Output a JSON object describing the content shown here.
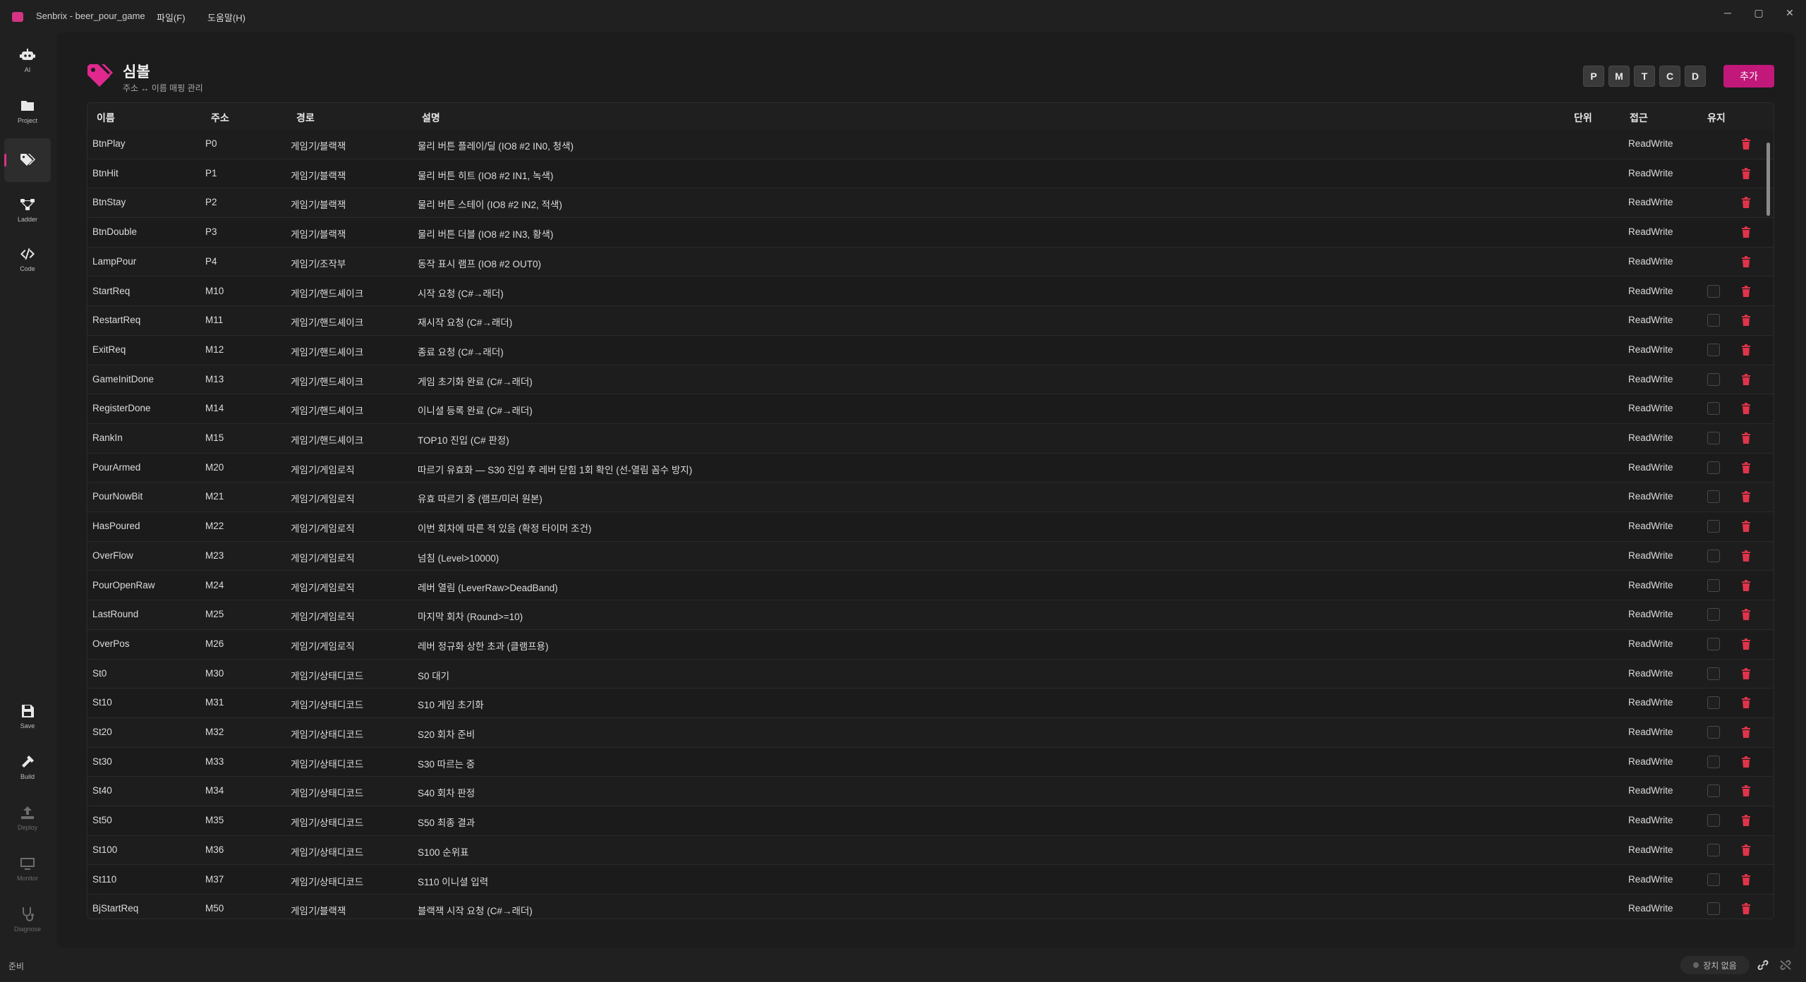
{
  "app": {
    "title": "Senbrix - beer_pour_game",
    "menu": [
      "파일(F)",
      "도움말(H)"
    ],
    "window_controls": [
      "─",
      "▢",
      "✕"
    ]
  },
  "rail": [
    {
      "label": "AI",
      "icon": "robot-icon",
      "active": false,
      "dim": false
    },
    {
      "label": "Project",
      "icon": "folder-icon",
      "active": false,
      "dim": false
    },
    {
      "label": "",
      "icon": "tag-icon",
      "active": true,
      "dim": false
    },
    {
      "label": "Ladder",
      "icon": "ladder-icon",
      "active": false,
      "dim": false
    },
    {
      "label": "Code",
      "icon": "code-icon",
      "active": false,
      "dim": false
    },
    {
      "label": "Save",
      "icon": "save-icon",
      "active": false,
      "dim": false
    },
    {
      "label": "Build",
      "icon": "hammer-icon",
      "active": false,
      "dim": false
    },
    {
      "label": "Deploy",
      "icon": "upload-icon",
      "active": false,
      "dim": true
    },
    {
      "label": "Monitor",
      "icon": "monitor-icon",
      "active": false,
      "dim": true
    },
    {
      "label": "Diagnose",
      "icon": "stethoscope-icon",
      "active": false,
      "dim": true
    }
  ],
  "header": {
    "title": "심볼",
    "subtitle": "주소 ↔ 이름 매핑 관리",
    "filters": [
      "P",
      "M",
      "T",
      "C",
      "D"
    ],
    "add_label": "추가",
    "accent": "#c2187a"
  },
  "table": {
    "columns": [
      "이름",
      "주소",
      "경로",
      "설명",
      "단위",
      "접근",
      "유지"
    ],
    "rows": [
      {
        "name": "BtnPlay",
        "addr": "P0",
        "path": "게임기/블랙잭",
        "desc": "물리 버튼 플레이/딜 (IO8 #2 IN0, 청색)",
        "unit": "",
        "access": "ReadWrite",
        "keep": false,
        "keep_visible": false
      },
      {
        "name": "BtnHit",
        "addr": "P1",
        "path": "게임기/블랙잭",
        "desc": "물리 버튼 히트 (IO8 #2 IN1, 녹색)",
        "unit": "",
        "access": "ReadWrite",
        "keep": false,
        "keep_visible": false
      },
      {
        "name": "BtnStay",
        "addr": "P2",
        "path": "게임기/블랙잭",
        "desc": "물리 버튼 스테이 (IO8 #2 IN2, 적색)",
        "unit": "",
        "access": "ReadWrite",
        "keep": false,
        "keep_visible": false
      },
      {
        "name": "BtnDouble",
        "addr": "P3",
        "path": "게임기/블랙잭",
        "desc": "물리 버튼 더블 (IO8 #2 IN3, 황색)",
        "unit": "",
        "access": "ReadWrite",
        "keep": false,
        "keep_visible": false
      },
      {
        "name": "LampPour",
        "addr": "P4",
        "path": "게임기/조작부",
        "desc": "동작 표시 램프 (IO8 #2 OUT0)",
        "unit": "",
        "access": "ReadWrite",
        "keep": false,
        "keep_visible": false
      },
      {
        "name": "StartReq",
        "addr": "M10",
        "path": "게임기/핸드셰이크",
        "desc": "시작 요청 (C#→래더)",
        "unit": "",
        "access": "ReadWrite",
        "keep": false,
        "keep_visible": true
      },
      {
        "name": "RestartReq",
        "addr": "M11",
        "path": "게임기/핸드셰이크",
        "desc": "재시작 요청 (C#→래더)",
        "unit": "",
        "access": "ReadWrite",
        "keep": false,
        "keep_visible": true
      },
      {
        "name": "ExitReq",
        "addr": "M12",
        "path": "게임기/핸드셰이크",
        "desc": "종료 요청 (C#→래더)",
        "unit": "",
        "access": "ReadWrite",
        "keep": false,
        "keep_visible": true
      },
      {
        "name": "GameInitDone",
        "addr": "M13",
        "path": "게임기/핸드셰이크",
        "desc": "게임 초기화 완료 (C#→래더)",
        "unit": "",
        "access": "ReadWrite",
        "keep": false,
        "keep_visible": true
      },
      {
        "name": "RegisterDone",
        "addr": "M14",
        "path": "게임기/핸드셰이크",
        "desc": "이니셜 등록 완료 (C#→래더)",
        "unit": "",
        "access": "ReadWrite",
        "keep": false,
        "keep_visible": true
      },
      {
        "name": "RankIn",
        "addr": "M15",
        "path": "게임기/핸드셰이크",
        "desc": "TOP10 진입 (C# 판정)",
        "unit": "",
        "access": "ReadWrite",
        "keep": false,
        "keep_visible": true
      },
      {
        "name": "PourArmed",
        "addr": "M20",
        "path": "게임기/게임로직",
        "desc": "따르기 유효화 — S30 진입 후 레버 닫힘 1회 확인 (선-열림 꼼수 방지)",
        "unit": "",
        "access": "ReadWrite",
        "keep": false,
        "keep_visible": true
      },
      {
        "name": "PourNowBit",
        "addr": "M21",
        "path": "게임기/게임로직",
        "desc": "유효 따르기 중 (램프/미러 원본)",
        "unit": "",
        "access": "ReadWrite",
        "keep": false,
        "keep_visible": true
      },
      {
        "name": "HasPoured",
        "addr": "M22",
        "path": "게임기/게임로직",
        "desc": "이번 회차에 따른 적 있음 (확정 타이머 조건)",
        "unit": "",
        "access": "ReadWrite",
        "keep": false,
        "keep_visible": true
      },
      {
        "name": "OverFlow",
        "addr": "M23",
        "path": "게임기/게임로직",
        "desc": "넘침 (Level>10000)",
        "unit": "",
        "access": "ReadWrite",
        "keep": false,
        "keep_visible": true
      },
      {
        "name": "PourOpenRaw",
        "addr": "M24",
        "path": "게임기/게임로직",
        "desc": "레버 열림 (LeverRaw>DeadBand)",
        "unit": "",
        "access": "ReadWrite",
        "keep": false,
        "keep_visible": true
      },
      {
        "name": "LastRound",
        "addr": "M25",
        "path": "게임기/게임로직",
        "desc": "마지막 회차 (Round>=10)",
        "unit": "",
        "access": "ReadWrite",
        "keep": false,
        "keep_visible": true
      },
      {
        "name": "OverPos",
        "addr": "M26",
        "path": "게임기/게임로직",
        "desc": "레버 정규화 상한 초과 (클램프용)",
        "unit": "",
        "access": "ReadWrite",
        "keep": false,
        "keep_visible": true
      },
      {
        "name": "St0",
        "addr": "M30",
        "path": "게임기/상태디코드",
        "desc": "S0 대기",
        "unit": "",
        "access": "ReadWrite",
        "keep": false,
        "keep_visible": true
      },
      {
        "name": "St10",
        "addr": "M31",
        "path": "게임기/상태디코드",
        "desc": "S10 게임 초기화",
        "unit": "",
        "access": "ReadWrite",
        "keep": false,
        "keep_visible": true
      },
      {
        "name": "St20",
        "addr": "M32",
        "path": "게임기/상태디코드",
        "desc": "S20 회차 준비",
        "unit": "",
        "access": "ReadWrite",
        "keep": false,
        "keep_visible": true
      },
      {
        "name": "St30",
        "addr": "M33",
        "path": "게임기/상태디코드",
        "desc": "S30 따르는 중",
        "unit": "",
        "access": "ReadWrite",
        "keep": false,
        "keep_visible": true
      },
      {
        "name": "St40",
        "addr": "M34",
        "path": "게임기/상태디코드",
        "desc": "S40 회차 판정",
        "unit": "",
        "access": "ReadWrite",
        "keep": false,
        "keep_visible": true
      },
      {
        "name": "St50",
        "addr": "M35",
        "path": "게임기/상태디코드",
        "desc": "S50 최종 결과",
        "unit": "",
        "access": "ReadWrite",
        "keep": false,
        "keep_visible": true
      },
      {
        "name": "St100",
        "addr": "M36",
        "path": "게임기/상태디코드",
        "desc": "S100 순위표",
        "unit": "",
        "access": "ReadWrite",
        "keep": false,
        "keep_visible": true
      },
      {
        "name": "St110",
        "addr": "M37",
        "path": "게임기/상태디코드",
        "desc": "S110 이니셜 입력",
        "unit": "",
        "access": "ReadWrite",
        "keep": false,
        "keep_visible": true
      },
      {
        "name": "BjStartReq",
        "addr": "M50",
        "path": "게임기/블랙잭",
        "desc": "블랙잭 시작 요청 (C#→래더)",
        "unit": "",
        "access": "ReadWrite",
        "keep": false,
        "keep_visible": true
      }
    ]
  },
  "status": {
    "text": "준비",
    "device": "장치 없음"
  }
}
